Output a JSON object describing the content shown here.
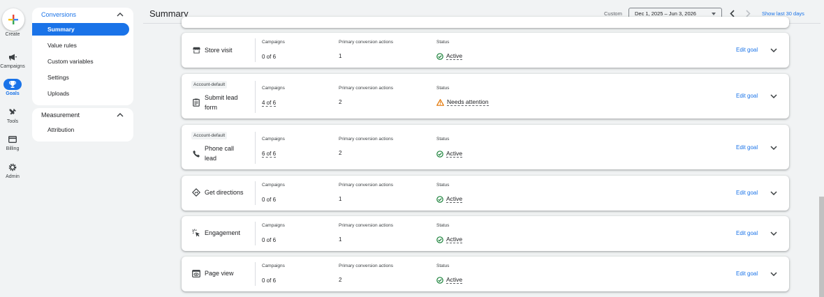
{
  "rail": {
    "create": "Create",
    "items": [
      {
        "label": "Campaigns",
        "icon": "megaphone-icon"
      },
      {
        "label": "Goals",
        "icon": "trophy-icon"
      },
      {
        "label": "Tools",
        "icon": "tools-icon"
      },
      {
        "label": "Billing",
        "icon": "credit-card-icon"
      },
      {
        "label": "Admin",
        "icon": "gear-icon"
      }
    ]
  },
  "nav": {
    "conversions": {
      "header": "Conversions",
      "items": [
        "Summary",
        "Value rules",
        "Custom variables",
        "Settings",
        "Uploads"
      ]
    },
    "measurement": {
      "header": "Measurement",
      "items": [
        "Attribution"
      ]
    }
  },
  "header": {
    "title": "Summary",
    "custom_label": "Custom",
    "date_range": "Dec 1, 2025 – Jun 3, 2026",
    "show_last": "Show last 30 days"
  },
  "columns": {
    "campaigns": "Campaigns",
    "primary": "Primary conversion actions",
    "status": "Status"
  },
  "edit_goal_label": "Edit goal",
  "goals": [
    {
      "name": "Store visit",
      "badge": "",
      "icon": "store-icon",
      "campaigns": "0 of 6",
      "campaigns_link": false,
      "primary": "1",
      "status": "Active",
      "status_type": "active"
    },
    {
      "name": "Submit lead form",
      "badge": "Account-default",
      "icon": "form-icon",
      "campaigns": "4 of 6",
      "campaigns_link": true,
      "primary": "2",
      "status": "Needs attention",
      "status_type": "warning"
    },
    {
      "name": "Phone call lead",
      "badge": "Account-default",
      "icon": "phone-icon",
      "campaigns": "6 of 6",
      "campaigns_link": true,
      "primary": "2",
      "status": "Active",
      "status_type": "active"
    },
    {
      "name": "Get directions",
      "badge": "",
      "icon": "directions-icon",
      "campaigns": "0 of 6",
      "campaigns_link": false,
      "primary": "1",
      "status": "Active",
      "status_type": "active"
    },
    {
      "name": "Engagement",
      "badge": "",
      "icon": "engagement-icon",
      "campaigns": "0 of 6",
      "campaigns_link": false,
      "primary": "1",
      "status": "Active",
      "status_type": "active"
    },
    {
      "name": "Page view",
      "badge": "",
      "icon": "page-view-icon",
      "campaigns": "0 of 6",
      "campaigns_link": false,
      "primary": "2",
      "status": "Active",
      "status_type": "active"
    }
  ],
  "colors": {
    "accent": "#1a73e8",
    "active": "#188038",
    "warning": "#e37400"
  }
}
